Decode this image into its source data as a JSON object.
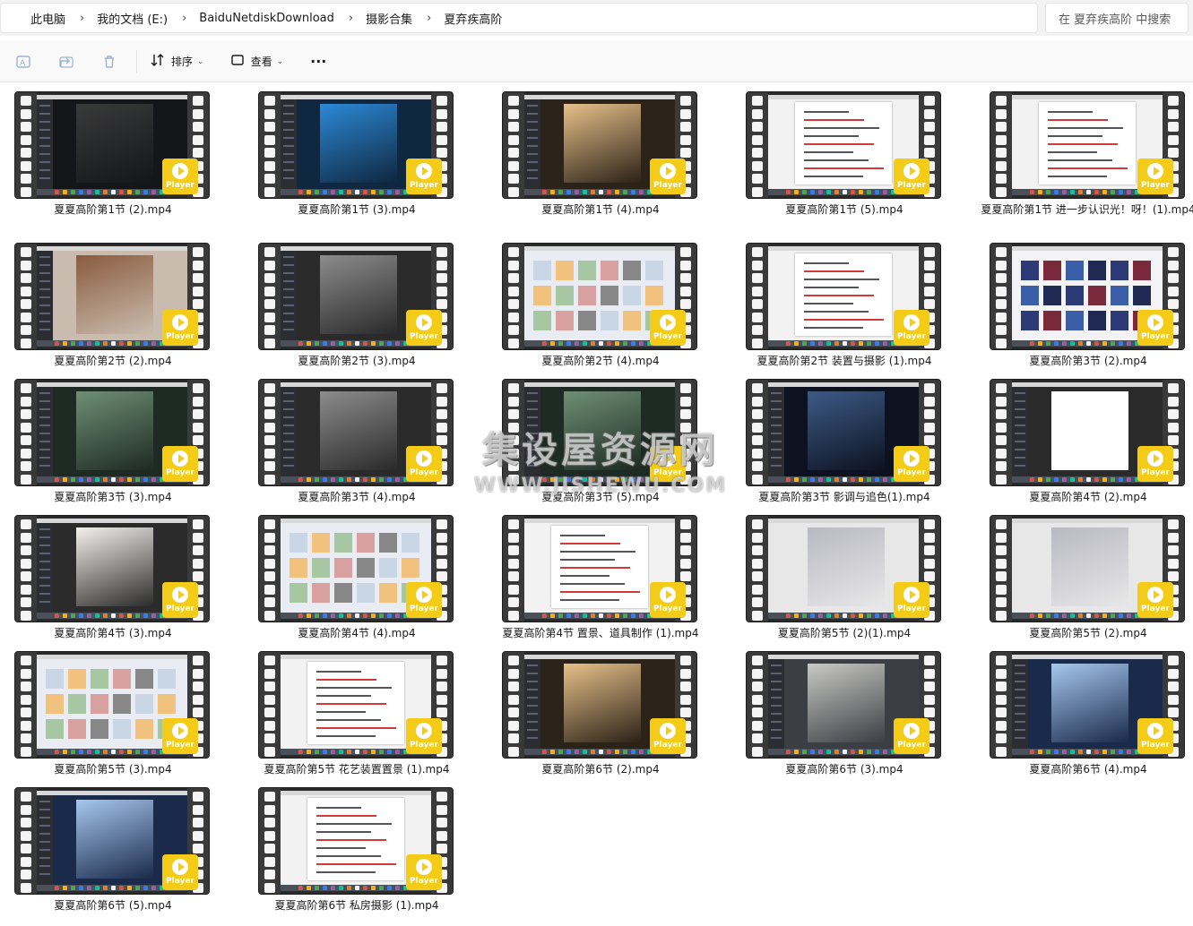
{
  "breadcrumb": [
    "此电脑",
    "我的文档 (E:)",
    "BaiduNetdiskDownload",
    "摄影合集",
    "夏弃疾高阶"
  ],
  "search": {
    "placeholder": "在 夏弃疾高阶 中搜索"
  },
  "toolbar": {
    "sort_label": "排序",
    "view_label": "查看",
    "more_label": "···"
  },
  "player_badge": "Player",
  "files": [
    {
      "name": "夏夏高阶第1节 (2).mp4",
      "theme": "dark"
    },
    {
      "name": "夏夏高阶第1节 (3).mp4",
      "theme": "blue"
    },
    {
      "name": "夏夏高阶第1节 (4).mp4",
      "theme": "warm"
    },
    {
      "name": "夏夏高阶第1节 (5).mp4",
      "theme": "doc"
    },
    {
      "name": "夏夏高阶第1节 进一步认识光！呀！(1).mp4",
      "theme": "doc"
    },
    {
      "name": "夏夏高阶第2节 (2).mp4",
      "theme": "room"
    },
    {
      "name": "夏夏高阶第2节 (3).mp4",
      "theme": "grey"
    },
    {
      "name": "夏夏高阶第2节 (4).mp4",
      "theme": "web"
    },
    {
      "name": "夏夏高阶第2节 装置与摄影 (1).mp4",
      "theme": "doc"
    },
    {
      "name": "夏夏高阶第3节 (2).mp4",
      "theme": "grid"
    },
    {
      "name": "夏夏高阶第3节 (3).mp4",
      "theme": "green"
    },
    {
      "name": "夏夏高阶第3节 (4).mp4",
      "theme": "grey"
    },
    {
      "name": "夏夏高阶第3节 (5).mp4",
      "theme": "green"
    },
    {
      "name": "夏夏高阶第3节 影调与追色(1).mp4",
      "theme": "night"
    },
    {
      "name": "夏夏高阶第4节 (2).mp4",
      "theme": "white"
    },
    {
      "name": "夏夏高阶第4节 (3).mp4",
      "theme": "sketch"
    },
    {
      "name": "夏夏高阶第4节 (4).mp4",
      "theme": "web"
    },
    {
      "name": "夏夏高阶第4节 置景、道具制作 (1).mp4",
      "theme": "doc"
    },
    {
      "name": "夏夏高阶第5节 (2)(1).mp4",
      "theme": "flower"
    },
    {
      "name": "夏夏高阶第5节 (2).mp4",
      "theme": "flower"
    },
    {
      "name": "夏夏高阶第5节 (3).mp4",
      "theme": "web"
    },
    {
      "name": "夏夏高阶第5节 花艺装置置景 (1).mp4",
      "theme": "doc"
    },
    {
      "name": "夏夏高阶第6节 (2).mp4",
      "theme": "warm"
    },
    {
      "name": "夏夏高阶第6节 (3).mp4",
      "theme": "window"
    },
    {
      "name": "夏夏高阶第6节 (4).mp4",
      "theme": "bluefull"
    },
    {
      "name": "夏夏高阶第6节 (5).mp4",
      "theme": "bluefull"
    },
    {
      "name": "夏夏高阶第6节 私房摄影 (1).mp4",
      "theme": "doc"
    }
  ],
  "theme_colors": {
    "dark": [
      "#15161a",
      "#3a3a3a"
    ],
    "blue": [
      "#0f2740",
      "#2c89d6"
    ],
    "warm": [
      "#2b2218",
      "#e7c08a"
    ],
    "doc": [
      "#f2f2f2",
      "#ffffff"
    ],
    "room": [
      "#c9bcae",
      "#8a5b3e"
    ],
    "grey": [
      "#2a2a2a",
      "#8c8c8c"
    ],
    "web": [
      "#e9edf3",
      "#ffffff"
    ],
    "grid": [
      "#f3f3f6",
      "#2d3a78"
    ],
    "green": [
      "#1e2a24",
      "#6e8f74"
    ],
    "night": [
      "#0d1220",
      "#3c5a86"
    ],
    "white": [
      "#2a2a2a",
      "#ffffff"
    ],
    "sketch": [
      "#2b2b2b",
      "#f4f1ec"
    ],
    "flower": [
      "#e7e7e7",
      "#b9b9c2"
    ],
    "window": [
      "#3b3f44",
      "#c9c9c4"
    ],
    "bluefull": [
      "#1a2a4a",
      "#a6c7ee"
    ]
  },
  "watermark": {
    "line1": "集设屋资源网",
    "line2": "WWW.JISHEWU.COM"
  }
}
